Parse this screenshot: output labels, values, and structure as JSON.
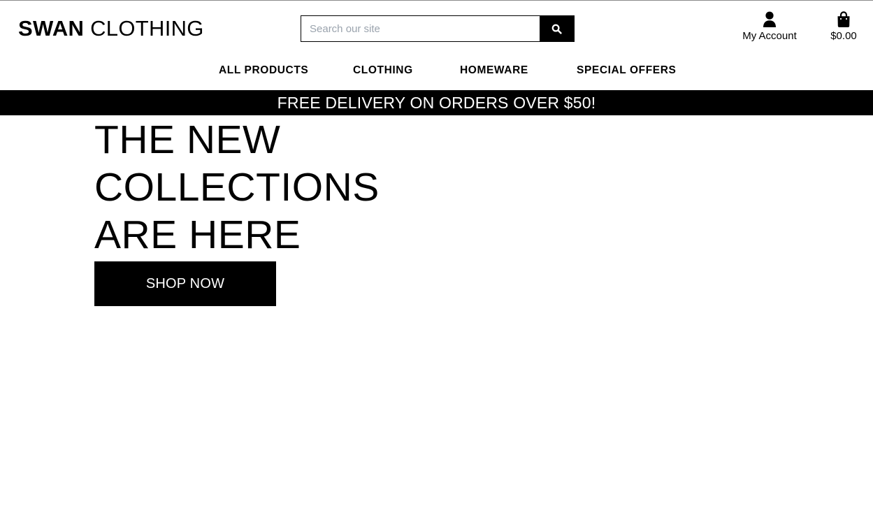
{
  "header": {
    "logo_brand": "SWAN",
    "logo_sub": "CLOTHING",
    "search_placeholder": "Search our site",
    "account_label": "My Account",
    "cart_total": "$0.00",
    "icons": {
      "search": "search-icon",
      "account": "user-icon",
      "cart": "shopping-bag-icon"
    }
  },
  "nav": {
    "items": [
      {
        "label": "ALL PRODUCTS"
      },
      {
        "label": "CLOTHING"
      },
      {
        "label": "HOMEWARE"
      },
      {
        "label": "SPECIAL OFFERS"
      }
    ]
  },
  "banner": {
    "text": "FREE DELIVERY ON ORDERS OVER $50!"
  },
  "hero": {
    "lines": [
      "THE NEW",
      "COLLECTIONS",
      "ARE HERE"
    ],
    "cta": "SHOP NOW"
  },
  "colors": {
    "primary": "#000000",
    "background": "#ffffff",
    "placeholder": "#9aa3ad"
  }
}
